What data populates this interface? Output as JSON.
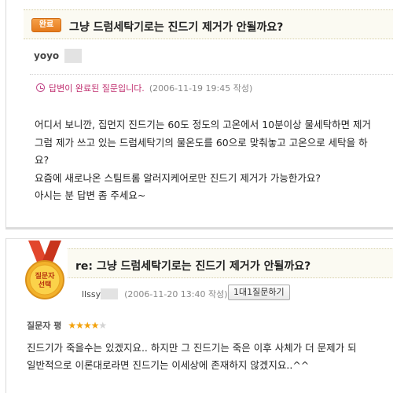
{
  "question": {
    "badge": "완료",
    "title": "그냥 드럼세탁기로는 진드기 제거가 안될까요?",
    "author": "yoyo",
    "status_text": "답변이 완료된 질문입니다.",
    "status_date": "(2006-11-19 19:45 작성)",
    "body_lines": [
      "어디서 보니깐, 집먼지 진드기는 60도 정도의 고온에서 10분이상 물세탁하면 제거",
      "그럼 제가 쓰고 있는 드럼세탁기의 물온도를 60으로 맞춰놓고 고온으로 세탁을 하",
      "요?",
      "요즘에 새로나온 스팀트롬 알러지케어로만 진드기 제거가 가능한가요?",
      "아시는 분 답변 좀 주세요~"
    ]
  },
  "answer": {
    "medal_line1": "질문자",
    "medal_line2": "선택",
    "title": "re: 그냥 드럼세탁기로는 진드기 제거가 안될까요?",
    "author": "llssy",
    "date": "(2006-11-20 13:40 작성)",
    "button_label": "1대1질문하기",
    "rating_label": "질문자 평",
    "rating_value": 4,
    "rating_max": 5,
    "stars_on": "★★★★",
    "stars_off": "★",
    "body_lines": [
      "진드기가 죽을수는 있겠지요.. 하지만 그 진드기는 죽은 이후 사체가 더 문제가 되",
      "일반적으로 이론대로라면 진드기는 이세상에 존재하지 않겠지요..^^"
    ]
  },
  "colors": {
    "badge_orange": "#e57a1c",
    "status_pink": "#c03070",
    "star_gold": "#f3a20c",
    "header_bg": "#fbfaf2"
  }
}
